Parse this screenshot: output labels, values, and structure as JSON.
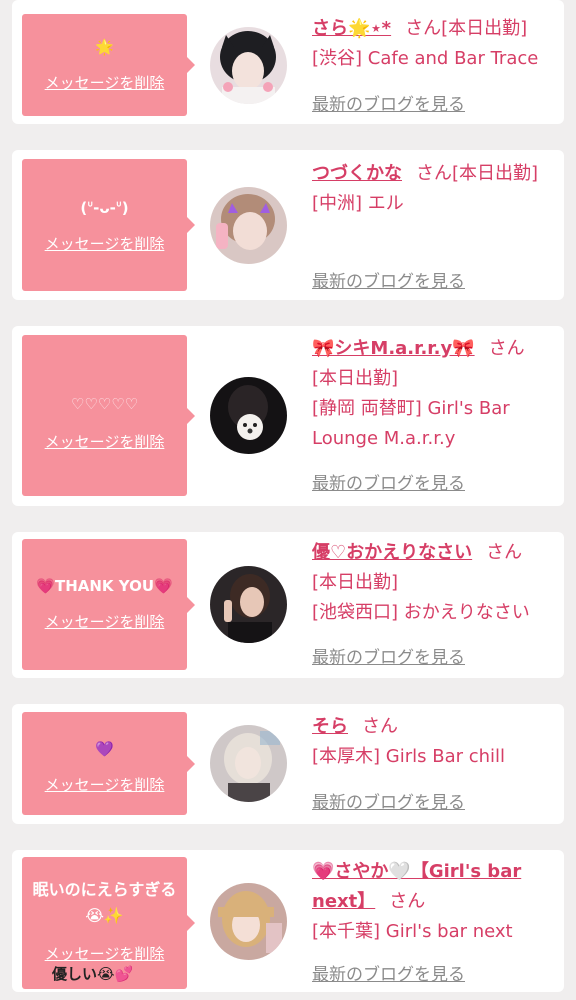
{
  "common": {
    "delete_label": "メッセージを削除",
    "blog_label": "最新のブログを見る",
    "san": "さん"
  },
  "colors": {
    "background": "#f0eeee",
    "card": "#ffffff",
    "bubble": "#f6919c",
    "name": "#d63e66",
    "blog_link": "#8b8b8b"
  },
  "entries": [
    {
      "message": "🌟",
      "name": "さら🌟⋆*",
      "line2": "[本日出勤]",
      "line3": "[渋谷] Cafe and Bar Trace",
      "avatar": "girl-with-black-hair-and-bunny-ears"
    },
    {
      "message": "(ᐡ-ᴗ-ᐡ)",
      "name": "つづくかな",
      "line2": "[本日出勤]",
      "line3": "[中洲] エル",
      "avatar": "girl-with-purple-devil-horns"
    },
    {
      "message": "♡♡♡♡♡",
      "name": "🎀シキM.a.r.r.y🎀",
      "line2": "[本日出勤]",
      "line3": "[静岡 両替町] Girl's Bar Lounge M.a.r.r.y",
      "avatar": "dark-photo-with-dog-sticker"
    },
    {
      "message": "💗THANK YOU💗",
      "name": "優♡おかえりなさい",
      "line2": "[本日出勤]",
      "line3": "[池袋西口] おかえりなさい",
      "avatar": "woman-posing-in-black-dress"
    },
    {
      "message": "💜",
      "name": "そら",
      "line2": "",
      "line3": "[本厚木] Girls Bar chill",
      "avatar": "blonde-girl-blurred"
    },
    {
      "message": "眠いのにえらすぎる😭✨",
      "message_extra": "優しい😭💕",
      "name": "💗さやか🤍【Girl's bar next】",
      "line2": "",
      "line3": "[本千葉] Girl's bar next",
      "avatar": "blonde-girl-with-bangs"
    }
  ]
}
